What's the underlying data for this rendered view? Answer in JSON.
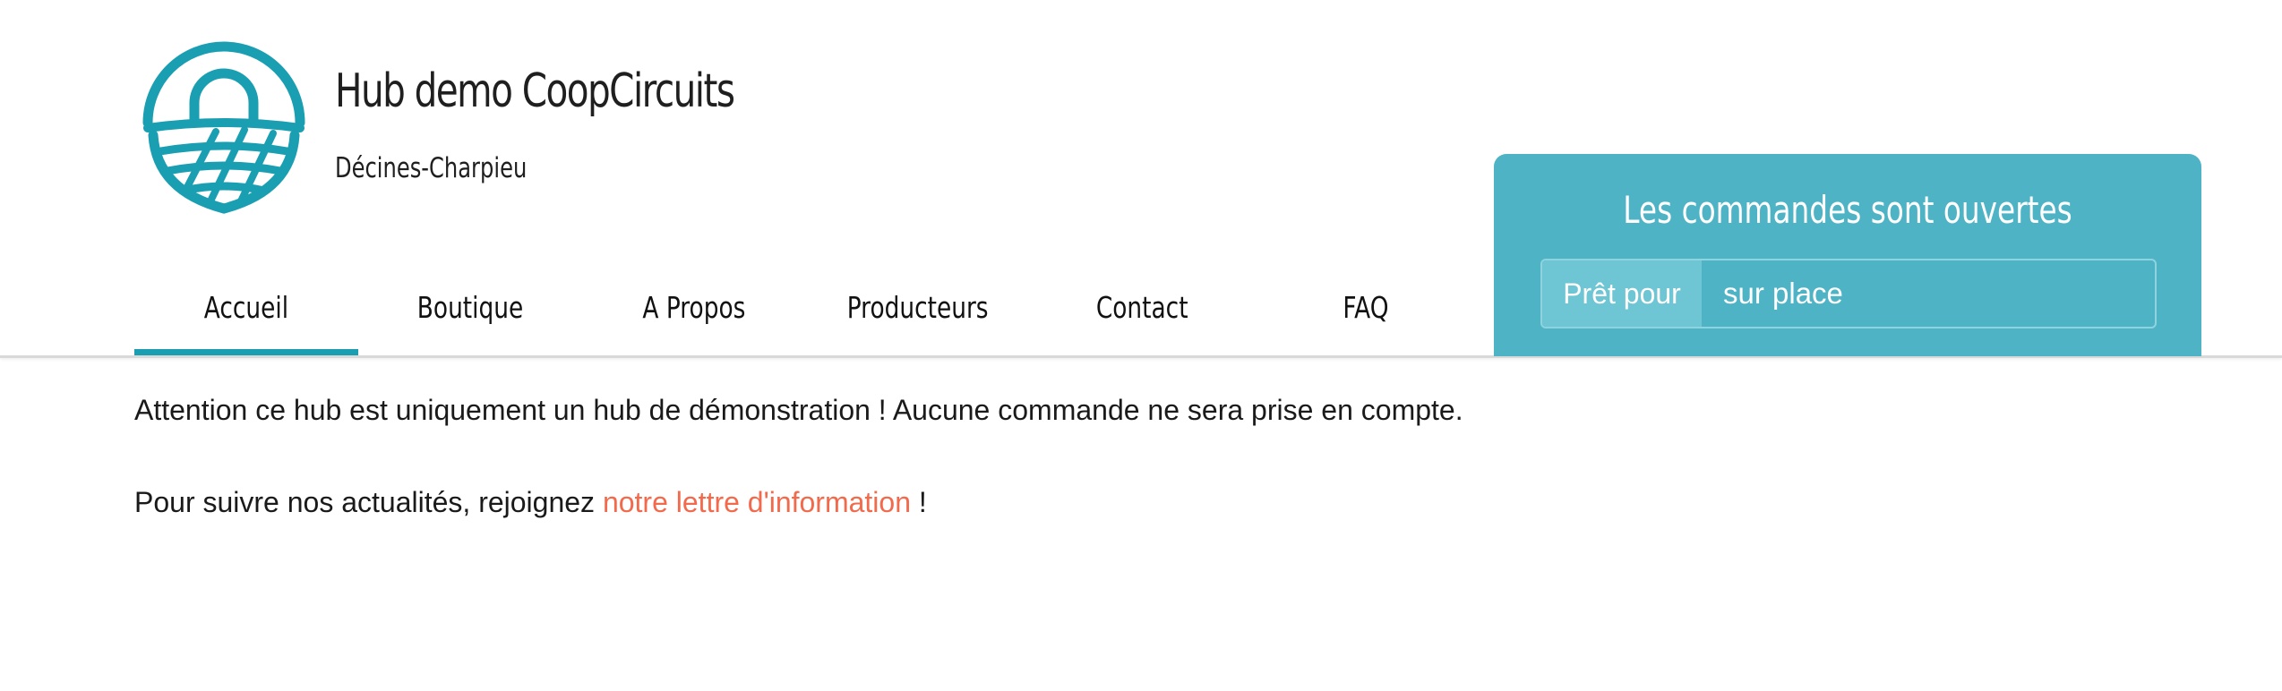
{
  "hub": {
    "name": "Hub demo CoopCircuits",
    "city": "Décines-Charpieu",
    "logo": "basket-icon",
    "brand_color": "#1a9fb2"
  },
  "nav": {
    "items": [
      {
        "label": "Accueil",
        "active": true
      },
      {
        "label": "Boutique",
        "active": false
      },
      {
        "label": "A Propos",
        "active": false
      },
      {
        "label": "Producteurs",
        "active": false
      },
      {
        "label": "Contact",
        "active": false
      },
      {
        "label": "FAQ",
        "active": false
      }
    ]
  },
  "orders": {
    "title": "Les commandes sont ouvertes",
    "pickup_label": "Prêt pour",
    "pickup_value": "sur place",
    "panel_color": "#4db3c5"
  },
  "content": {
    "notice": "Attention ce hub est uniquement un hub de démonstration ! Aucune commande ne sera prise en compte.",
    "news_prefix": "Pour suivre nos actualités, rejoignez ",
    "news_link": "notre lettre d'information",
    "news_suffix": " !",
    "link_color": "#f26a4b"
  }
}
